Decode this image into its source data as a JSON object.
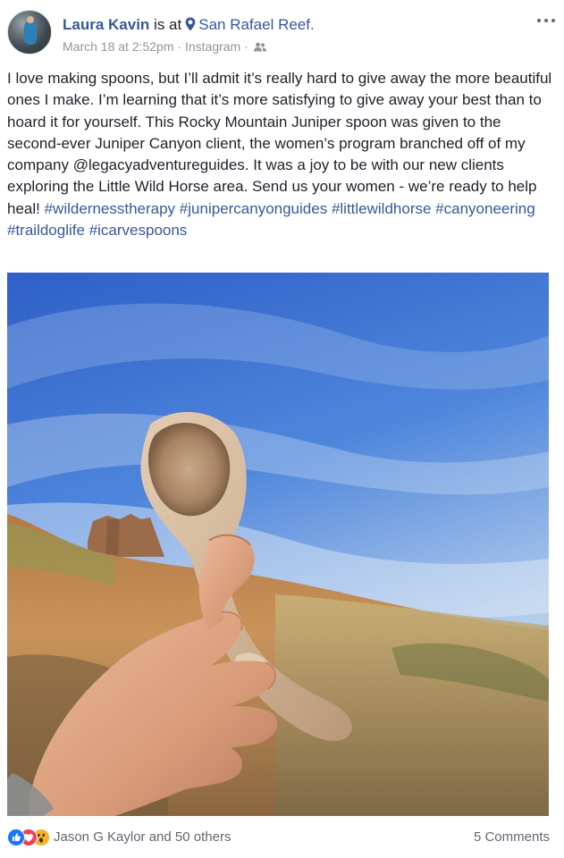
{
  "header": {
    "name": "Laura Kavin",
    "is_at": "is at",
    "location": "San Rafael Reef.",
    "date": "March 18 at 2:52pm",
    "separator": "·",
    "app": "Instagram",
    "separator2": "·"
  },
  "post": {
    "text_lines": [
      "I love making spoons, but I’ll admit it’s really hard to give away the more",
      "beautiful ones I make. I’m learning that it’s more satisfying to give away",
      "your best than to hoard it for yourself. This Rocky Mountain Juniper",
      "spoon was given to the second-ever Juniper Canyon client, the women’s",
      "program branched off of my company @legacyadventureguides. It was a",
      "joy to be with our new clients exploring the Little Wild Horse area. Send",
      "us your women - we’re ready to help heal! "
    ],
    "hashtags": [
      "#wildernesstherapy",
      "#junipercanyonguides",
      "#littlewildhorse",
      "#canyoneering",
      "#traildoglife",
      "#icarvespoons"
    ]
  },
  "footer": {
    "reactions_text": "Jason G Kaylor and 50 others",
    "comments_text": "5 Comments"
  },
  "icons": {
    "location": "map-pin-icon",
    "audience": "friends-icon",
    "more": "more-options-icon",
    "reactions": [
      "like-reaction-icon",
      "love-reaction-icon",
      "wow-reaction-icon"
    ]
  },
  "colors": {
    "link": "#365899",
    "text": "#1d2129",
    "meta": "#90949c",
    "footer_text": "#606770",
    "like": "#1877f2",
    "love": "#f33e58",
    "wow": "#f7b125"
  }
}
